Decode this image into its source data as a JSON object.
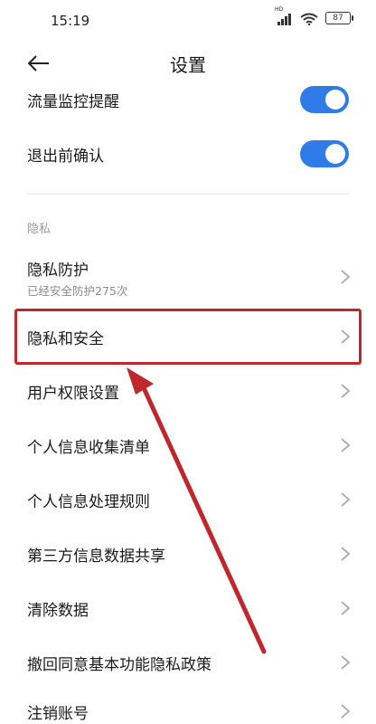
{
  "status_bar": {
    "time": "15:19",
    "network_label": "HD",
    "battery": "87"
  },
  "header": {
    "title": "设置",
    "back_icon": "back-arrow-icon"
  },
  "toggles": [
    {
      "label": "流量监控提醒",
      "enabled": true
    },
    {
      "label": "退出前确认",
      "enabled": true
    }
  ],
  "section": {
    "header": "隐私"
  },
  "items": [
    {
      "label": "隐私防护",
      "sublabel": "已经安全防护275次"
    },
    {
      "label": "隐私和安全"
    },
    {
      "label": "用户权限设置"
    },
    {
      "label": "个人信息收集清单"
    },
    {
      "label": "个人信息处理规则"
    },
    {
      "label": "第三方信息数据共享"
    },
    {
      "label": "清除数据"
    },
    {
      "label": "撤回同意基本功能隐私政策"
    },
    {
      "label": "注销账号"
    }
  ],
  "colors": {
    "toggle_on": "#2f7be8",
    "annotation": "#c0272d"
  }
}
